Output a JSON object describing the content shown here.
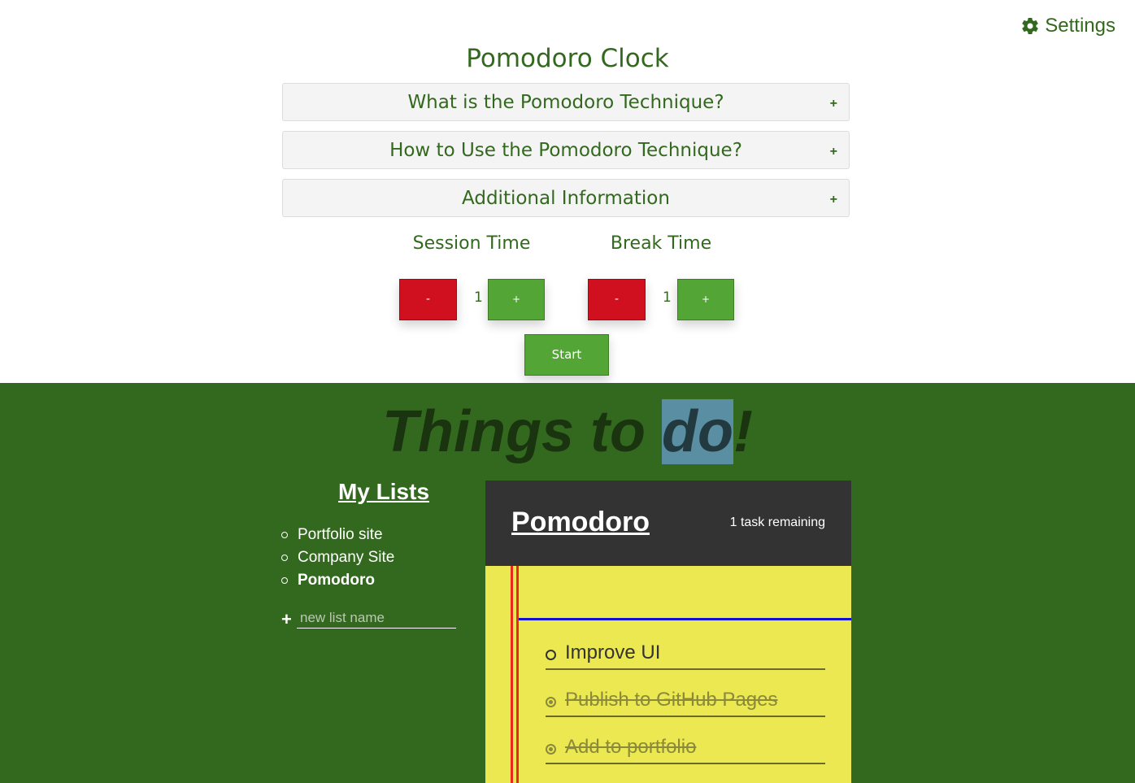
{
  "settings": {
    "label": "Settings",
    "icon": "gear-icon"
  },
  "clock": {
    "title": "Pomodoro Clock",
    "sections": [
      {
        "label": "What is the Pomodoro Technique?",
        "toggle": "+"
      },
      {
        "label": "How to Use the Pomodoro Technique?",
        "toggle": "+"
      },
      {
        "label": "Additional Information",
        "toggle": "+"
      }
    ],
    "session": {
      "label": "Session Time",
      "minus": "-",
      "value": "1",
      "plus": "+"
    },
    "break": {
      "label": "Break Time",
      "minus": "-",
      "value": "1",
      "plus": "+"
    },
    "start_label": "Start"
  },
  "todo": {
    "title_before": "Things to ",
    "title_highlight": "do",
    "title_after": "!",
    "my_lists_title": "My Lists",
    "lists": [
      {
        "label": "Portfolio site",
        "active": false
      },
      {
        "label": "Company Site",
        "active": false
      },
      {
        "label": "Pomodoro",
        "active": true
      }
    ],
    "new_list": {
      "placeholder": "new list name",
      "icon": "plus-icon"
    },
    "panel": {
      "title": "Pomodoro",
      "remaining": "1 task remaining",
      "tasks": [
        {
          "text": "Improve UI",
          "done": false
        },
        {
          "text": "Publish to GitHub Pages",
          "done": true
        },
        {
          "text": "Add to portfolio",
          "done": true
        }
      ]
    }
  },
  "colors": {
    "accent_green": "#33691e",
    "button_green": "#53a635",
    "button_red": "#d00f1f",
    "paper_yellow": "#ece852",
    "panel_dark": "#333333"
  }
}
